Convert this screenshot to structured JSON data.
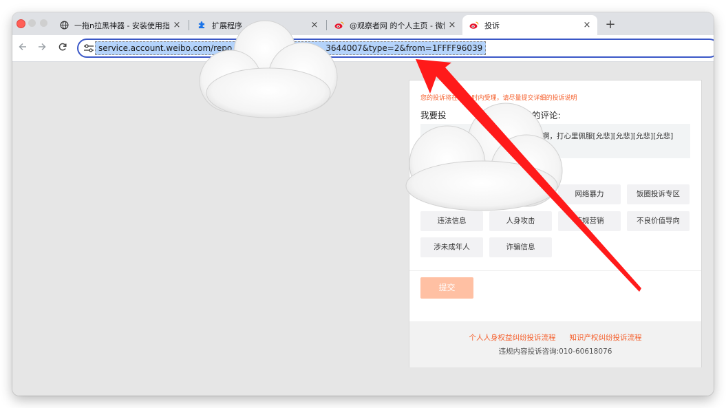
{
  "browser": {
    "tabs": [
      {
        "title": "一拖n拉黑神器 - 安装使用指南",
        "icon": "globe-icon"
      },
      {
        "title": "扩展程序",
        "icon": "puzzle-icon"
      },
      {
        "title": "@观察者网 的个人主页 - 微博",
        "icon": "weibo-icon"
      },
      {
        "title": "投诉",
        "icon": "weibo-icon"
      }
    ],
    "new_tab_label": "+",
    "close_label": "×",
    "url": "service.account.weibo.com/repo",
    "url_tail": "3644007&type=2&from=1FFFF96039"
  },
  "report": {
    "notice": "您的投诉将在24小时内受理，请尽量提交详细的投诉说明",
    "heading_prefix": "我要投",
    "heading_suffix": "发的评论:",
    "comment_text": "啊，打心里佩服[允悲][允悲][允悲][允悲]",
    "reasons": [
      "网络暴力",
      "饭圈投诉专区",
      "违法信息",
      "人身攻击",
      "违规营销",
      "不良价值导向",
      "涉未成年人",
      "诈骗信息"
    ],
    "submit_label": "提交",
    "footer_links": [
      "个人人身权益纠纷投诉流程",
      "知识产权纠纷投诉流程"
    ],
    "footer_contact": "违规内容投诉咨询:010-60618076"
  },
  "colors": {
    "accent": "#f5602d",
    "submit_bg": "#ffc0a3",
    "focus_ring": "#3a57c7",
    "arrow": "#ff1a1a"
  }
}
